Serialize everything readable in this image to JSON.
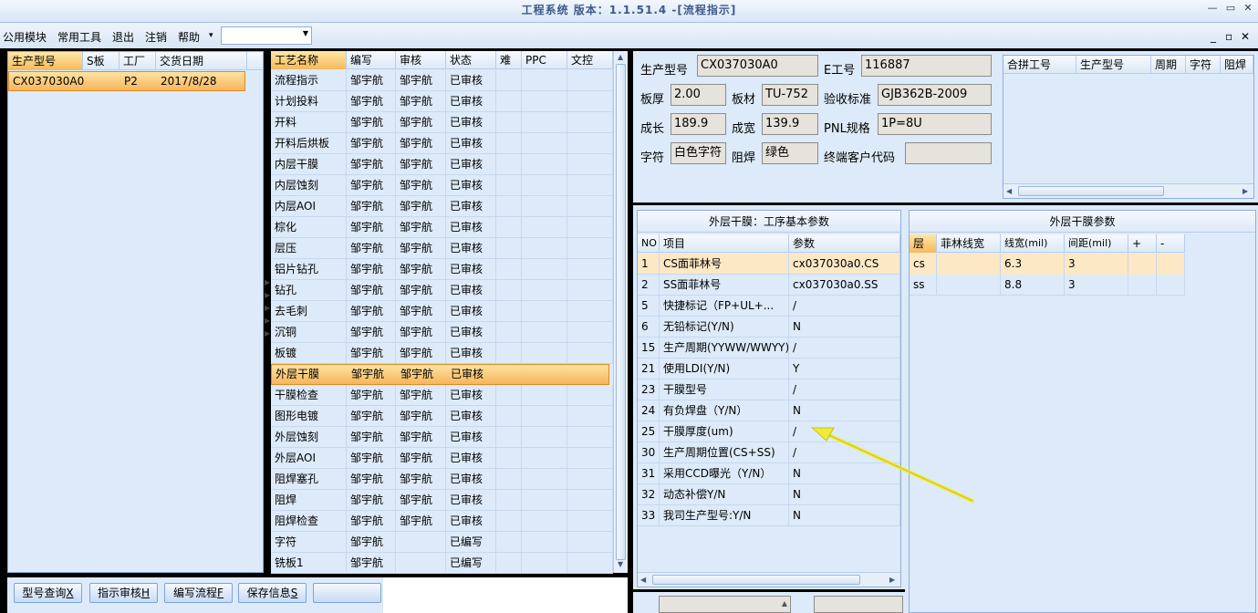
{
  "window": {
    "title": "工程系统  版本：1.1.51.4 -[流程指示]",
    "controls": [
      "—",
      "▭",
      "✕"
    ]
  },
  "menu": {
    "items": [
      "公用模块",
      "常用工具",
      "退出",
      "注销",
      "帮助"
    ],
    "dropdown_arrow": "▾",
    "combo_value": "",
    "mdi_controls": [
      "_",
      "▫",
      "✕"
    ]
  },
  "orders": {
    "headers": [
      "生产型号",
      "S板",
      "工厂",
      "交货日期"
    ],
    "rows": [
      [
        "CX037030A0",
        "",
        "P2",
        "2017/8/28"
      ]
    ]
  },
  "process": {
    "headers": [
      "工艺名称",
      "编写",
      "审核",
      "状态",
      "难",
      "PPC",
      "文控"
    ],
    "rows": [
      [
        "流程指示",
        "邹宇航",
        "邹宇航",
        "已审核"
      ],
      [
        "计划投料",
        "邹宇航",
        "邹宇航",
        "已审核"
      ],
      [
        "开料",
        "邹宇航",
        "邹宇航",
        "已审核"
      ],
      [
        "开料后烘板",
        "邹宇航",
        "邹宇航",
        "已审核"
      ],
      [
        "内层干膜",
        "邹宇航",
        "邹宇航",
        "已审核"
      ],
      [
        "内层蚀刻",
        "邹宇航",
        "邹宇航",
        "已审核"
      ],
      [
        "内层AOI",
        "邹宇航",
        "邹宇航",
        "已审核"
      ],
      [
        "棕化",
        "邹宇航",
        "邹宇航",
        "已审核"
      ],
      [
        "层压",
        "邹宇航",
        "邹宇航",
        "已审核"
      ],
      [
        "铝片钻孔",
        "邹宇航",
        "邹宇航",
        "已审核"
      ],
      [
        "钻孔",
        "邹宇航",
        "邹宇航",
        "已审核"
      ],
      [
        "去毛刺",
        "邹宇航",
        "邹宇航",
        "已审核"
      ],
      [
        "沉铜",
        "邹宇航",
        "邹宇航",
        "已审核"
      ],
      [
        "板镀",
        "邹宇航",
        "邹宇航",
        "已审核"
      ],
      [
        "外层干膜",
        "邹宇航",
        "邹宇航",
        "已审核"
      ],
      [
        "干膜检查",
        "邹宇航",
        "邹宇航",
        "已审核"
      ],
      [
        "图形电镀",
        "邹宇航",
        "邹宇航",
        "已审核"
      ],
      [
        "外层蚀刻",
        "邹宇航",
        "邹宇航",
        "已审核"
      ],
      [
        "外层AOI",
        "邹宇航",
        "邹宇航",
        "已审核"
      ],
      [
        "阻焊塞孔",
        "邹宇航",
        "邹宇航",
        "已审核"
      ],
      [
        "阻焊",
        "邹宇航",
        "邹宇航",
        "已审核"
      ],
      [
        "阻焊检查",
        "邹宇航",
        "邹宇航",
        "已审核"
      ],
      [
        "字符",
        "邹宇航",
        "",
        "已编写"
      ],
      [
        "铣板1",
        "邹宇航",
        "",
        "已编写"
      ]
    ],
    "selected_index": 14
  },
  "buttons": [
    {
      "label": "型号查询",
      "key": "X"
    },
    {
      "label": "指示审核",
      "key": "H"
    },
    {
      "label": "编写流程",
      "key": "F"
    },
    {
      "label": "保存信息",
      "key": "S"
    },
    {
      "label": "",
      "key": ""
    }
  ],
  "info": {
    "fields": [
      {
        "label": "生产型号",
        "value": "CX037030A0"
      },
      {
        "label": "E工号",
        "value": "116887"
      },
      {
        "label": "板厚",
        "value": "2.00"
      },
      {
        "label": "板材",
        "value": "TU-752"
      },
      {
        "label": "验收标准",
        "value": "GJB362B-2009"
      },
      {
        "label": "成长",
        "value": "189.9"
      },
      {
        "label": "成宽",
        "value": "139.9"
      },
      {
        "label": "PNL规格",
        "value": "1P=8U"
      },
      {
        "label": "字符",
        "value": "白色字符"
      },
      {
        "label": "阻焊",
        "value": "绿色"
      },
      {
        "label": "终端客户代码",
        "value": ""
      }
    ]
  },
  "merge": {
    "headers": [
      "合拼工号",
      "生产型号",
      "周期",
      "字符",
      "阻焊"
    ]
  },
  "basic_params": {
    "title": "外层干膜：工序基本参数",
    "headers": [
      "NO",
      "项目",
      "参数"
    ],
    "rows": [
      [
        "1",
        "CS面菲林号",
        "cx037030a0.CS"
      ],
      [
        "2",
        "SS面菲林号",
        "cx037030a0.SS"
      ],
      [
        "5",
        "快捷标记（FP+UL+...",
        "/"
      ],
      [
        "6",
        "无铅标记(Y/N)",
        "N"
      ],
      [
        "15",
        "生产周期(YYWW/WWYY)",
        "/"
      ],
      [
        "21",
        "使用LDI(Y/N)",
        "Y"
      ],
      [
        "23",
        "干膜型号",
        "/"
      ],
      [
        "24",
        "有负焊盘（Y/N）",
        "N"
      ],
      [
        "25",
        "干膜厚度(um)",
        "/"
      ],
      [
        "30",
        "生产周期位置(CS+SS)",
        "/"
      ],
      [
        "31",
        "采用CCD曝光（Y/N）",
        "N"
      ],
      [
        "32",
        "动态补偿Y/N",
        "N"
      ],
      [
        "33",
        "我司生产型号:Y/N",
        "N"
      ]
    ]
  },
  "film_params": {
    "title": "外层干膜参数",
    "headers": [
      "层",
      "菲林线宽",
      "线宽(mil)",
      "间距(mil)",
      "+",
      "-"
    ],
    "rows": [
      [
        "cs",
        "",
        "6.3",
        "3",
        "",
        ""
      ],
      [
        "ss",
        "",
        "8.8",
        "3",
        "",
        ""
      ]
    ]
  },
  "colors": {
    "accent_selected": "#f7b95a",
    "annotation_arrow": "#f0ea3a"
  }
}
